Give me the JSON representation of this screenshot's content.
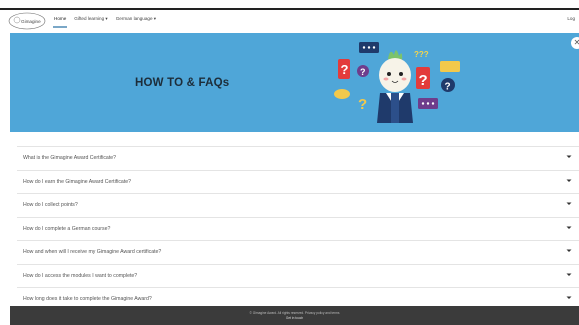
{
  "nav": {
    "logo_text": "Gimagine",
    "items": [
      {
        "label": "Home"
      },
      {
        "label": "Gifted learning ▾"
      },
      {
        "label": "German language ▾"
      }
    ],
    "right_text": "Log"
  },
  "banner": {
    "title": "HOW TO & FAQs",
    "close_symbol": "✕",
    "colors": {
      "background": "#4fa6d8"
    }
  },
  "faqs": [
    {
      "question": "What is the Gimagine Award Certificate?"
    },
    {
      "question": "How do I earn the Gimagine Award Certificate?"
    },
    {
      "question": "How do I collect points?"
    },
    {
      "question": "How do I complete a German course?"
    },
    {
      "question": "How and when will I receive my Gimagine Award certificate?"
    },
    {
      "question": "How do I access the modules I want to complete?"
    },
    {
      "question": "How long does it take to complete the Gimagine Award?"
    }
  ],
  "footer": {
    "line1": "© Gimagine Award. All rights reserved. Privacy policy and terms",
    "line2": "Get in touch"
  }
}
